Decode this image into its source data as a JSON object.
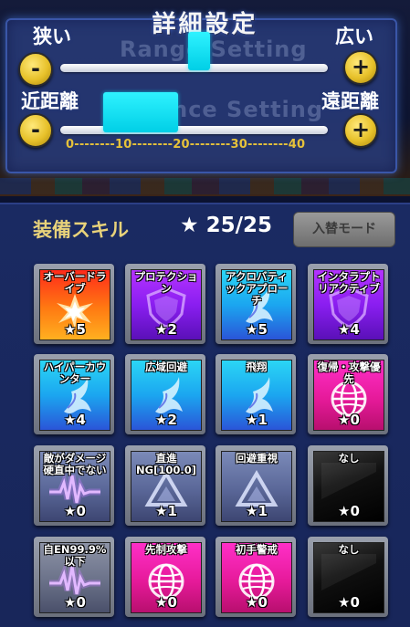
{
  "settings": {
    "title": "詳細設定",
    "range": {
      "min_label": "狭い",
      "max_label": "広い",
      "ghost_label": "Range Setting",
      "minus": "-",
      "plus": "+",
      "value_fraction": 0.52
    },
    "distance": {
      "min_label": "近距離",
      "max_label": "遠距離",
      "ghost_label": "Distance Setting",
      "minus": "-",
      "plus": "+",
      "value_fraction": 0.3,
      "scale": "0--------10--------20--------30--------40"
    }
  },
  "equip": {
    "title": "装備スキル",
    "star_count": "★ 25/25",
    "swap_button": "入替モード"
  },
  "skills": [
    {
      "name": "オーバードライブ",
      "stars": "★5",
      "color": "orange",
      "icon": "burst-icon"
    },
    {
      "name": "プロテクション",
      "stars": "★2",
      "color": "purple",
      "icon": "shield-icon"
    },
    {
      "name": "アクロバティックアプローチ",
      "stars": "★5",
      "color": "cyan",
      "icon": "wing-icon"
    },
    {
      "name": "インタラプトリアクティブ",
      "stars": "★4",
      "color": "purple",
      "icon": "shield-icon"
    },
    {
      "name": "ハイパーカウンター",
      "stars": "★4",
      "color": "cyan",
      "icon": "wing-icon"
    },
    {
      "name": "広域回避",
      "stars": "★2",
      "color": "cyan",
      "icon": "wing-icon"
    },
    {
      "name": "飛翔",
      "stars": "★1",
      "color": "cyan",
      "icon": "wing-icon"
    },
    {
      "name": "復帰・攻撃優先",
      "stars": "★0",
      "color": "pink",
      "icon": "globe-icon"
    },
    {
      "name": "敵がダメージ硬直中でない",
      "stars": "★0",
      "color": "slate",
      "icon": "pulse-icon"
    },
    {
      "name": "直進NG[100.0]",
      "stars": "★1",
      "color": "slate",
      "icon": "triangle-icon"
    },
    {
      "name": "回避重視",
      "stars": "★1",
      "color": "slate",
      "icon": "triangle-icon"
    },
    {
      "name": "なし",
      "stars": "★0",
      "color": "black",
      "icon": "empty-icon"
    },
    {
      "name": "自EN99.9%以下",
      "stars": "★0",
      "color": "gray",
      "icon": "pulse-icon"
    },
    {
      "name": "先制攻撃",
      "stars": "★0",
      "color": "pink",
      "icon": "globe-icon"
    },
    {
      "name": "初手警戒",
      "stars": "★0",
      "color": "pink",
      "icon": "globe-icon"
    },
    {
      "name": "なし",
      "stars": "★0",
      "color": "black",
      "icon": "empty-icon"
    }
  ]
}
